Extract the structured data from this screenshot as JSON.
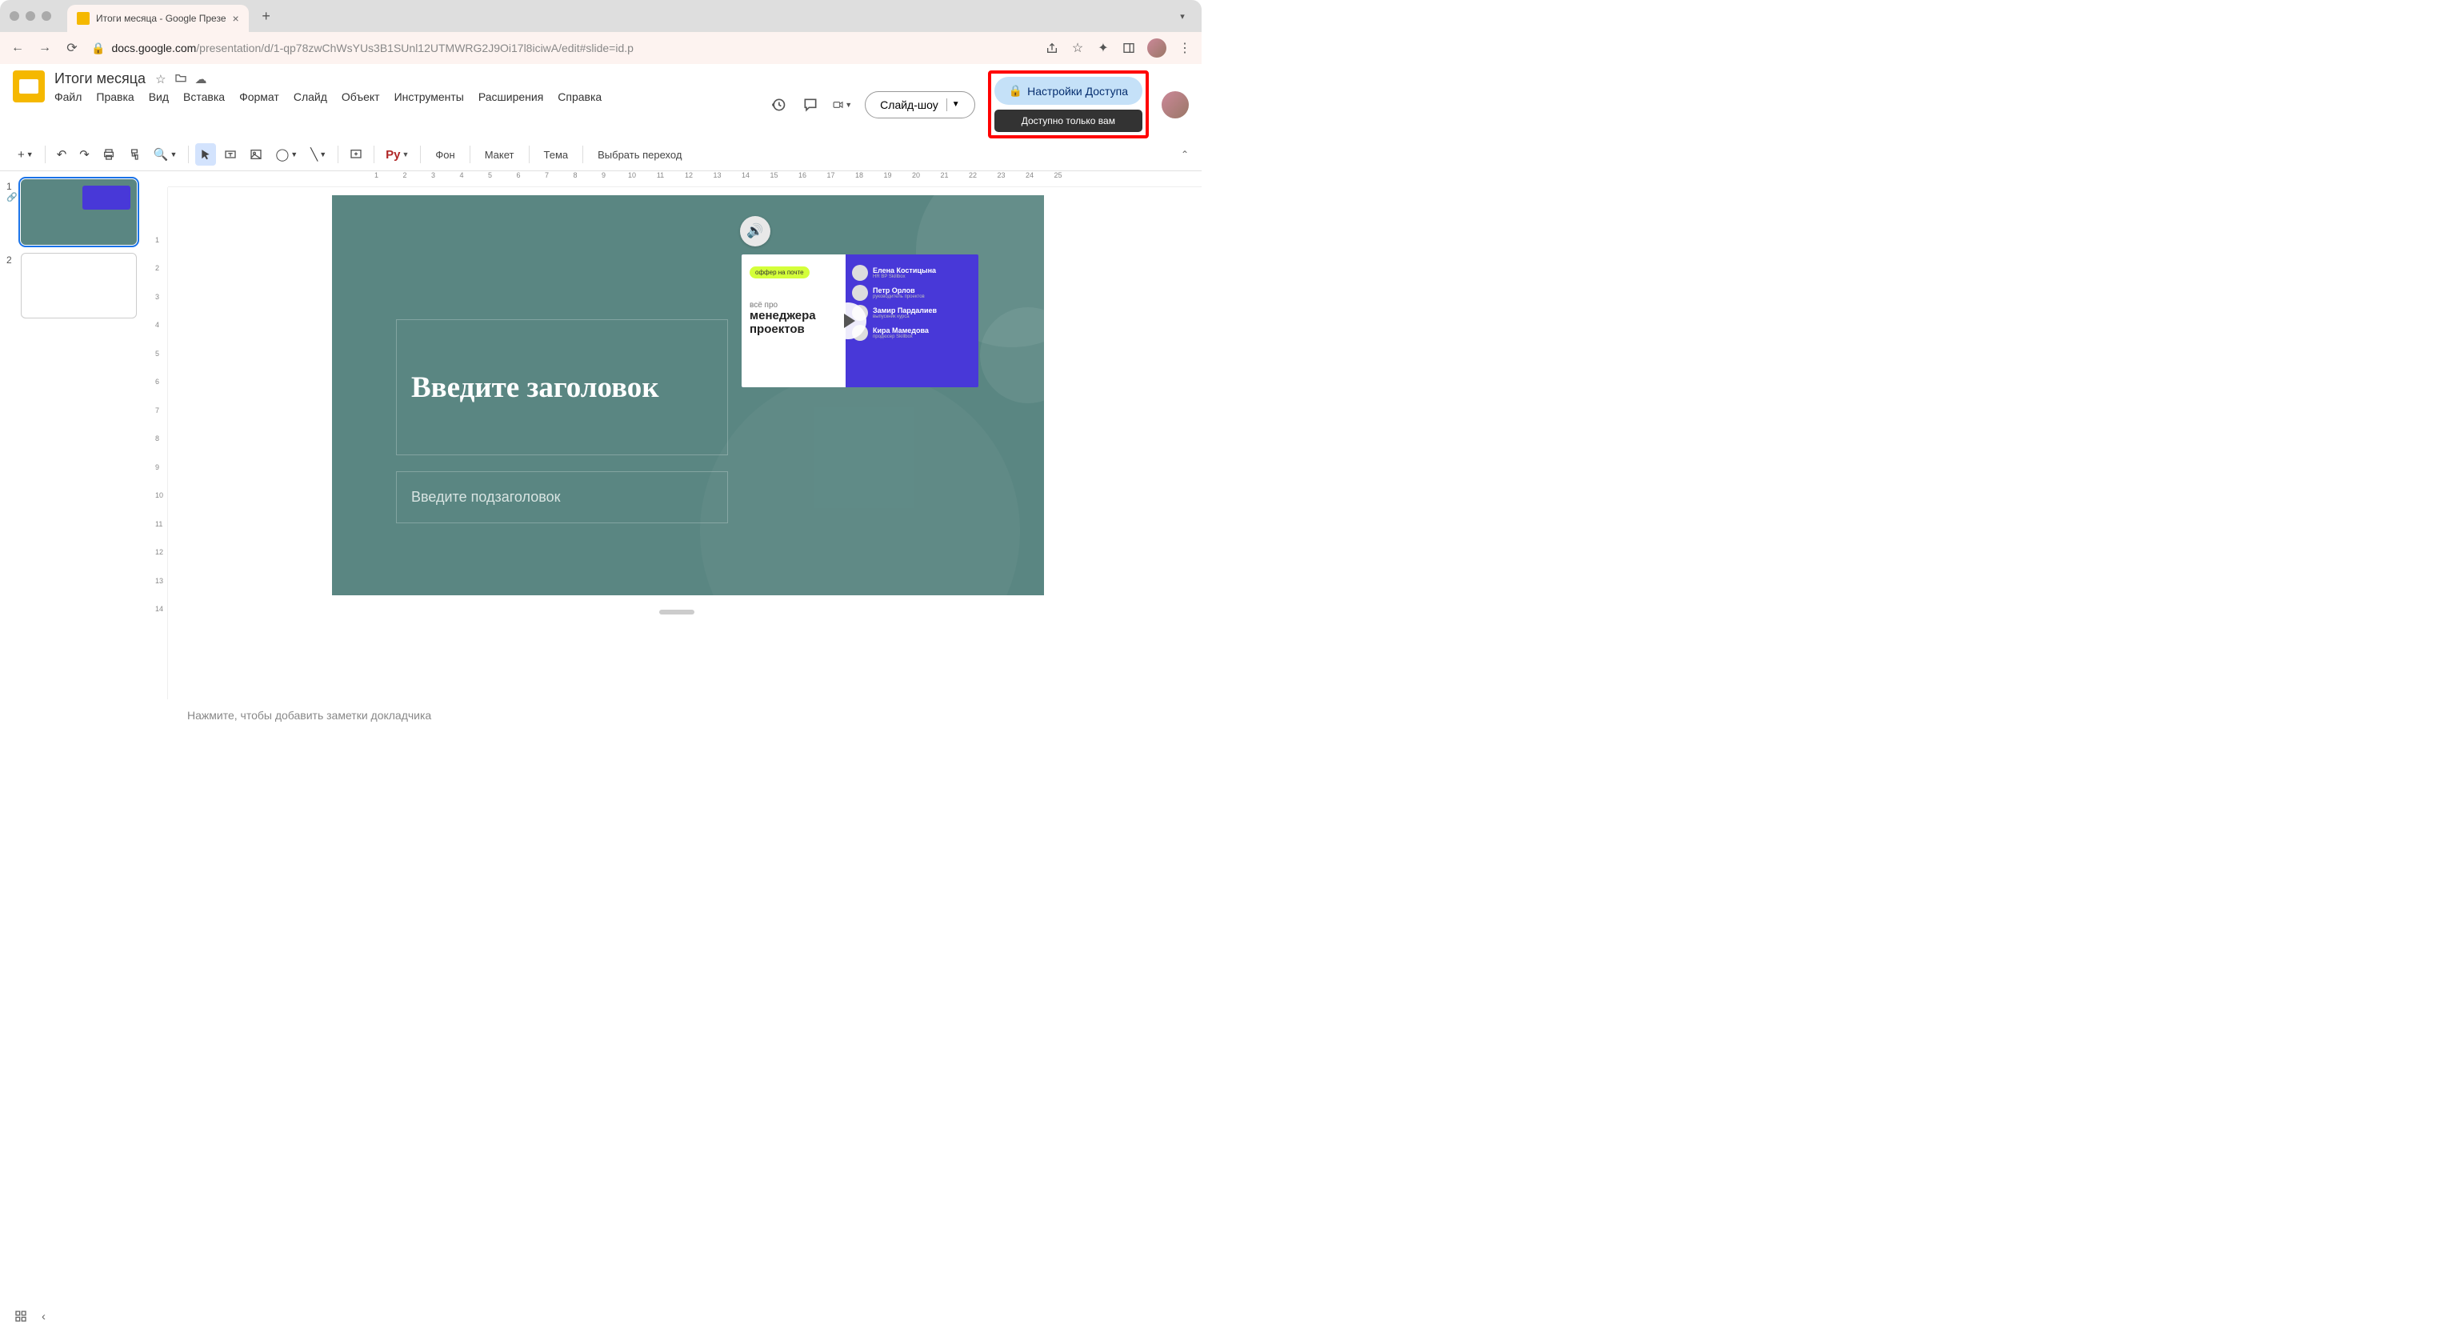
{
  "browser": {
    "tab_title": "Итоги месяца - Google Презе",
    "url_prefix": "docs.google.com",
    "url_path": "/presentation/d/1-qp78zwChWsYUs3B1SUnl12UTMWRG2J9Oi17l8iciwA/edit#slide=id.p"
  },
  "header": {
    "doc_title": "Итоги месяца",
    "menus": [
      "Файл",
      "Правка",
      "Вид",
      "Вставка",
      "Формат",
      "Слайд",
      "Объект",
      "Инструменты",
      "Расширения",
      "Справка"
    ],
    "slideshow_btn": "Слайд-шоу",
    "share_btn": "Настройки Доступа",
    "share_tooltip": "Доступно только вам"
  },
  "toolbar": {
    "font_btn": "Рy",
    "bg_btn": "Фон",
    "layout_btn": "Макет",
    "theme_btn": "Тема",
    "transition_btn": "Выбрать переход"
  },
  "filmstrip": {
    "slides": [
      {
        "num": "1"
      },
      {
        "num": "2"
      }
    ]
  },
  "slide": {
    "title_placeholder": "Введите заголовок",
    "subtitle_placeholder": "Введите подзаголовок",
    "video": {
      "pill": "оффер на почте",
      "line1": "всё про",
      "line2": "менеджера",
      "line3": "проектов",
      "people": [
        {
          "name": "Елена Костицына",
          "role": "HR BP Skillbox"
        },
        {
          "name": "Петр Орлов",
          "role": "руководитель проектов"
        },
        {
          "name": "Замир Пардалиев",
          "role": "выпускник курса"
        },
        {
          "name": "Кира Мамедова",
          "role": "продюсер Skillbox"
        }
      ]
    }
  },
  "ruler": {
    "h": [
      "",
      "1",
      "2",
      "3",
      "4",
      "5",
      "6",
      "7",
      "8",
      "9",
      "10",
      "11",
      "12",
      "13",
      "14",
      "15",
      "16",
      "17",
      "18",
      "19",
      "20",
      "21",
      "22",
      "23",
      "24",
      "25"
    ],
    "v": [
      "",
      "1",
      "2",
      "3",
      "4",
      "5",
      "6",
      "7",
      "8",
      "9",
      "10",
      "11",
      "12",
      "13",
      "14"
    ]
  },
  "notes_placeholder": "Нажмите, чтобы добавить заметки докладчика"
}
